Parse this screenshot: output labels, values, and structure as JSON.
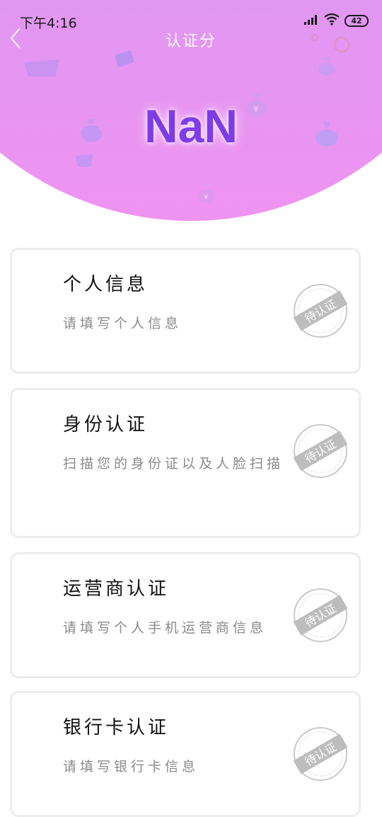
{
  "status_bar": {
    "time": "下午4:16",
    "battery": "42"
  },
  "header": {
    "title": "认证分",
    "score": "NaN",
    "gradient_top": "#c79af5",
    "gradient_bottom": "#ef93f1",
    "score_color": "#7e3be8"
  },
  "cards": [
    {
      "title": "个人信息",
      "description": "请填写个人信息",
      "stamp": "待认证"
    },
    {
      "title": "身份认证",
      "description": "扫描您的身份证以及人脸扫描",
      "stamp": "待认证"
    },
    {
      "title": "运营商认证",
      "description": "请填写个人手机运营商信息",
      "stamp": "待认证"
    },
    {
      "title": "银行卡认证",
      "description": "请填写银行卡信息",
      "stamp": "待认证"
    }
  ]
}
